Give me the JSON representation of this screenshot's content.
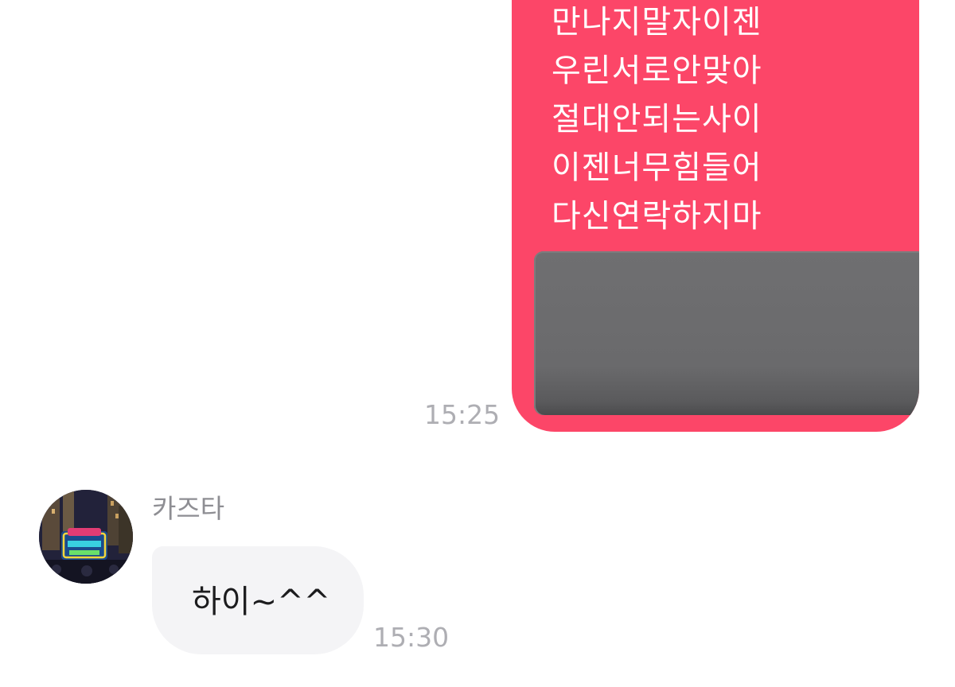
{
  "conversation": {
    "sent_message": {
      "lines": [
        "만나지말자이젠",
        "우린서로안맞아",
        "절대안되는사이",
        "이젠너무힘들어",
        "다신연락하지마"
      ],
      "time": "15:25"
    },
    "received_message": {
      "sender": "카즈타",
      "text": "하이~^^",
      "time": "15:30"
    }
  },
  "colors": {
    "sent_bubble": "#fc4668",
    "received_bubble": "#f4f4f6",
    "timestamp": "#aeaeb3",
    "sender_name": "#8e8e93",
    "redaction": "#6a6a6c"
  }
}
